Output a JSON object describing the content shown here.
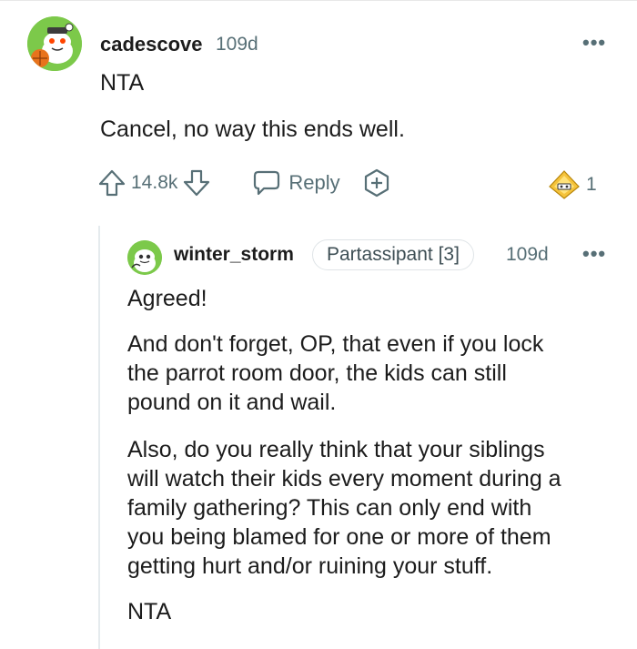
{
  "comment": {
    "author": "cadescove",
    "age": "109d",
    "more_label": "•••",
    "paragraphs": [
      "NTA",
      "Cancel, no way this ends well."
    ],
    "score": "14.8k",
    "reply_label": "Reply",
    "award_count": "1"
  },
  "reply": {
    "author": "winter_storm",
    "flair": "Partassipant [3]",
    "age": "109d",
    "more_label": "•••",
    "paragraphs": [
      "Agreed!",
      "And don't forget, OP, that even if you lock\nthe parrot room door, the kids can still\npound on it and wail.",
      "Also, do you really think that your siblings\nwill watch their kids every moment during a\nfamily gathering? This can only end with\nyou being blamed for one or more of them\ngetting hurt and/or ruining your stuff.",
      "NTA"
    ]
  },
  "colors": {
    "avatar_bg": "#7cc94a",
    "meta_text": "#576f76",
    "award_gold": "#f5c33b"
  },
  "icons": {
    "upvote": "arrow-up-icon",
    "downvote": "arrow-down-icon",
    "reply": "speech-bubble-icon",
    "award": "plus-circle-icon",
    "given_award": "gold-award-icon"
  }
}
